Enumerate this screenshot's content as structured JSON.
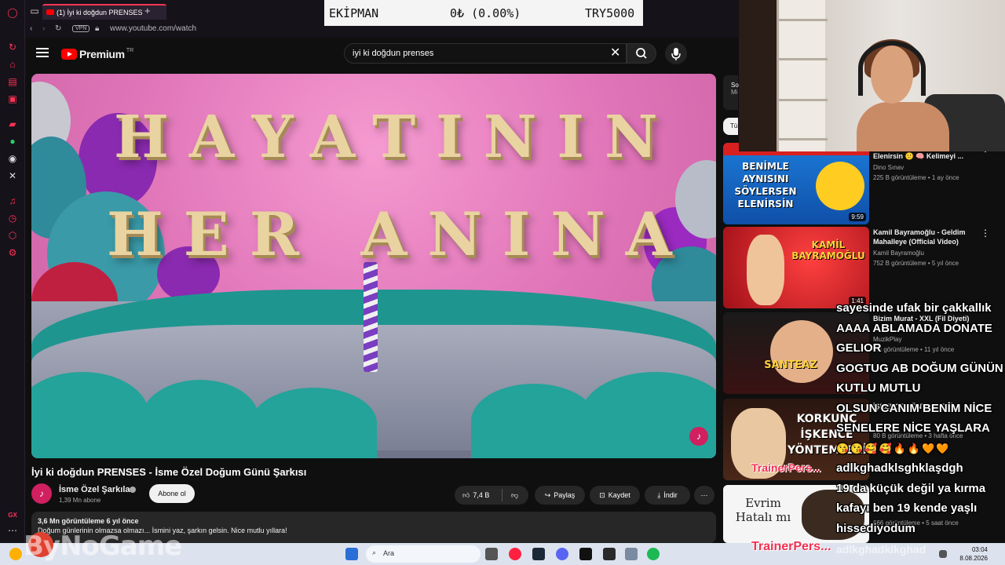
{
  "browser": {
    "tab_title": "(1) İyi ki doğdun PRENSES",
    "new_tab": "+",
    "vpn_label": "VPN",
    "url": "www.youtube.com/watch",
    "gx_label": "GX"
  },
  "youtube": {
    "logo_text": "Premium",
    "logo_country": "TR",
    "search_query": "iyi ki doğdun prenses",
    "video": {
      "frame_line1": "HAYATININ",
      "frame_line2": "HER ANINA",
      "title": "İyi ki doğdun PRENSES - İsme Özel Doğum Günü Şarkısı",
      "channel": "İsme Özel Şarkılar",
      "subscribers": "1,39 Mn abone",
      "subscribe_label": "Abone ol",
      "likes": "7,4 B",
      "share_label": "Paylaş",
      "save_label": "Kaydet",
      "download_label": "İndir",
      "views_age": "3,6 Mn görüntüleme  6 yıl önce",
      "description": "Doğum günlerinin olmazsa olmazı... İsmini yaz, şarkın gelsin. Nice mutlu yıllara!"
    },
    "related": [
      {
        "title": "Elenirsin 🙂 🧠 Kelimeyi ...",
        "channel": "Dino Sınav",
        "meta": "225 B görüntüleme • 1 ay önce",
        "duration": "9:59",
        "thumb_text": "BENİMLE AYNISINI SÖYLERSEN ELENİRSİN"
      },
      {
        "title": "Kamil Bayramoğlu - Geldim Mahalleye (Official Video)",
        "channel": "Kamil Bayramoğlu",
        "meta": "752 B görüntüleme • 5 yıl önce",
        "duration": "1:41",
        "thumb_text": "KAMİL BAYRAMOĞLU"
      },
      {
        "title": "Bizim Murat - XXL (Fil Diyeti)",
        "channel": "MuzikPlay",
        "meta": "Mn görüntüleme • 11 yıl önce",
        "duration": "",
        "thumb_text": "SANTEAZ"
      },
      {
        "title": "İŞKENCE YÖNTEMLERİ",
        "channel": "",
        "meta": "80 B görüntüleme • 3 hafta önce",
        "duration": "",
        "thumb_text": "KORKUNÇ İŞKENCE YÖNTEMLERİ"
      },
      {
        "title": "",
        "channel": "",
        "meta": "666 görüntüleme • 5 saat önce",
        "duration": "",
        "thumb_text": "Evrim Hatalı mı"
      }
    ],
    "filter_chip": "Tüm",
    "side_snippet_1": "So",
    "side_snippet_2": "Mi"
  },
  "ticker": {
    "label": "EKİPMAN",
    "value": "0₺ (0.00%)",
    "total": "TRY5000"
  },
  "chat": {
    "lines": [
      "sayesinde ufak bir çakkallık",
      "AAAA ABLAMADA DONATE GELIOR",
      "GOGTUG AB DOĞUM GÜNÜN KUTLU MUTLU",
      "OLSUN CANIM BENİM NİCE SENELERE NİCE YAŞLARA",
      "😘😘🥰🥰🔥🔥🧡🧡",
      "adlkghadklsghklaşdgh",
      "19 da küçük değil ya kırma",
      "kafayı ben 19 kende yaşlı",
      "hissediyodum",
      "adlkghadklkghad"
    ]
  },
  "watermarks": {
    "trainer": "TrainerPers...",
    "trainer_small": "TrainerPers...",
    "brand": "ByNoGame"
  },
  "taskbar": {
    "search_placeholder": "Ara",
    "time": "03:04",
    "date": "8.08.2026"
  }
}
